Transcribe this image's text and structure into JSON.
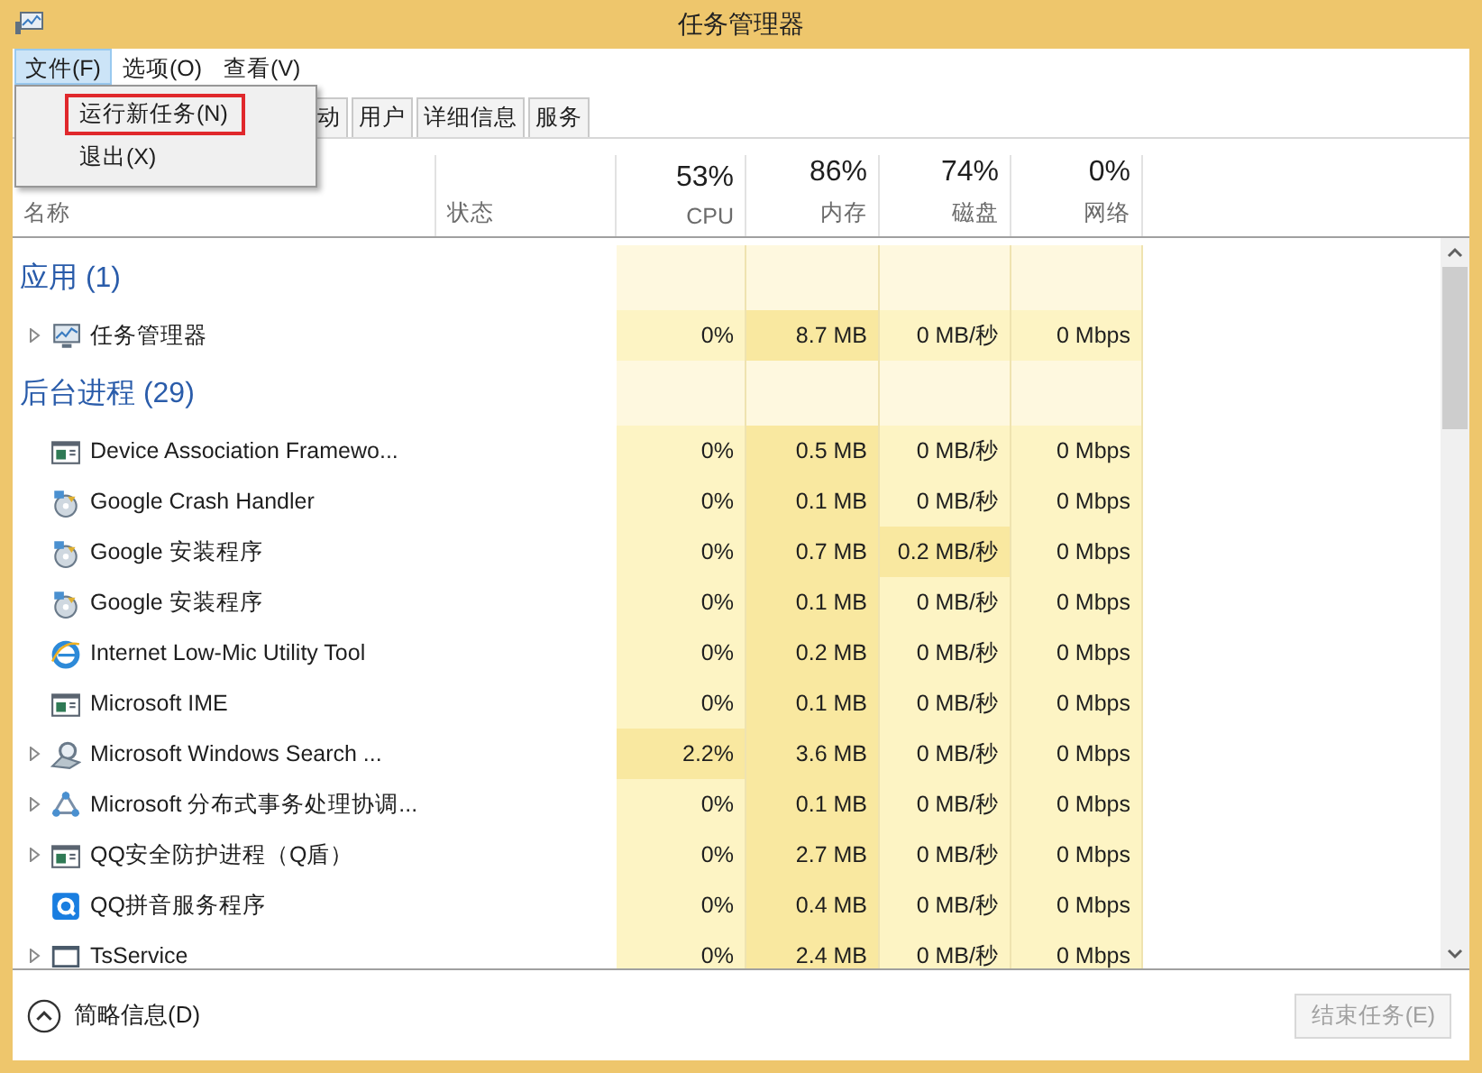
{
  "window": {
    "title": "任务管理器"
  },
  "menu_bar": [
    {
      "label": "文件(F)",
      "selected": true
    },
    {
      "label": "选项(O)",
      "selected": false
    },
    {
      "label": "查看(V)",
      "selected": false
    }
  ],
  "open_menu": {
    "items": [
      {
        "label": "运行新任务(N)",
        "highlighted": true
      },
      {
        "label": "退出(X)",
        "highlighted": false
      }
    ]
  },
  "tabs": [
    {
      "label": "动",
      "selected": false
    },
    {
      "label": "用户",
      "selected": false
    },
    {
      "label": "详细信息",
      "selected": false
    },
    {
      "label": "服务",
      "selected": false
    }
  ],
  "columns": [
    {
      "name": "名称"
    },
    {
      "name": "状态"
    },
    {
      "usage": "53%",
      "name": "CPU"
    },
    {
      "usage": "86%",
      "name": "内存"
    },
    {
      "usage": "74%",
      "name": "磁盘"
    },
    {
      "usage": "0%",
      "name": "网络"
    }
  ],
  "sections": [
    {
      "title": "应用 (1)",
      "rows": [
        {
          "name": "任务管理器",
          "kind": "monitor",
          "expandable": true,
          "cells": [
            {
              "text": "0%",
              "highlighted": false
            },
            {
              "text": "8.7 MB",
              "highlighted": true
            },
            {
              "text": "0 MB/秒",
              "highlighted": false
            },
            {
              "text": "0 Mbps",
              "highlighted": false
            }
          ]
        }
      ]
    },
    {
      "title": "后台进程 (29)",
      "rows": [
        {
          "name": "Device Association Framewo...",
          "kind": "window",
          "expandable": false,
          "cells": [
            {
              "text": "0%",
              "highlighted": false
            },
            {
              "text": "0.5 MB",
              "highlighted": true
            },
            {
              "text": "0 MB/秒",
              "highlighted": false
            },
            {
              "text": "0 Mbps",
              "highlighted": false
            }
          ]
        },
        {
          "name": "Google Crash Handler",
          "kind": "installer",
          "expandable": false,
          "cells": [
            {
              "text": "0%",
              "highlighted": false
            },
            {
              "text": "0.1 MB",
              "highlighted": true
            },
            {
              "text": "0 MB/秒",
              "highlighted": false
            },
            {
              "text": "0 Mbps",
              "highlighted": false
            }
          ]
        },
        {
          "name": "Google 安装程序",
          "kind": "installer",
          "expandable": false,
          "cells": [
            {
              "text": "0%",
              "highlighted": false
            },
            {
              "text": "0.7 MB",
              "highlighted": true
            },
            {
              "text": "0.2 MB/秒",
              "highlighted": true
            },
            {
              "text": "0 Mbps",
              "highlighted": false
            }
          ]
        },
        {
          "name": "Google 安装程序",
          "kind": "installer",
          "expandable": false,
          "cells": [
            {
              "text": "0%",
              "highlighted": false
            },
            {
              "text": "0.1 MB",
              "highlighted": true
            },
            {
              "text": "0 MB/秒",
              "highlighted": false
            },
            {
              "text": "0 Mbps",
              "highlighted": false
            }
          ]
        },
        {
          "name": "Internet Low-Mic Utility Tool",
          "kind": "browser",
          "expandable": false,
          "cells": [
            {
              "text": "0%",
              "highlighted": false
            },
            {
              "text": "0.2 MB",
              "highlighted": true
            },
            {
              "text": "0 MB/秒",
              "highlighted": false
            },
            {
              "text": "0 Mbps",
              "highlighted": false
            }
          ]
        },
        {
          "name": "Microsoft IME",
          "kind": "window",
          "expandable": false,
          "cells": [
            {
              "text": "0%",
              "highlighted": false
            },
            {
              "text": "0.1 MB",
              "highlighted": true
            },
            {
              "text": "0 MB/秒",
              "highlighted": false
            },
            {
              "text": "0 Mbps",
              "highlighted": false
            }
          ]
        },
        {
          "name": "Microsoft Windows Search ...",
          "kind": "search",
          "expandable": true,
          "cells": [
            {
              "text": "2.2%",
              "highlighted": true
            },
            {
              "text": "3.6 MB",
              "highlighted": true
            },
            {
              "text": "0 MB/秒",
              "highlighted": false
            },
            {
              "text": "0 Mbps",
              "highlighted": false
            }
          ]
        },
        {
          "name": "Microsoft 分布式事务处理协调...",
          "kind": "network",
          "expandable": true,
          "cells": [
            {
              "text": "0%",
              "highlighted": false
            },
            {
              "text": "0.1 MB",
              "highlighted": true
            },
            {
              "text": "0 MB/秒",
              "highlighted": false
            },
            {
              "text": "0 Mbps",
              "highlighted": false
            }
          ]
        },
        {
          "name": "QQ安全防护进程（Q盾）",
          "kind": "window",
          "expandable": true,
          "cells": [
            {
              "text": "0%",
              "highlighted": false
            },
            {
              "text": "2.7 MB",
              "highlighted": true
            },
            {
              "text": "0 MB/秒",
              "highlighted": false
            },
            {
              "text": "0 Mbps",
              "highlighted": false
            }
          ]
        },
        {
          "name": "QQ拼音服务程序",
          "kind": "q",
          "expandable": false,
          "cells": [
            {
              "text": "0%",
              "highlighted": false
            },
            {
              "text": "0.4 MB",
              "highlighted": true
            },
            {
              "text": "0 MB/秒",
              "highlighted": false
            },
            {
              "text": "0 Mbps",
              "highlighted": false
            }
          ]
        },
        {
          "name": "TsService",
          "kind": "blank",
          "expandable": true,
          "cells": [
            {
              "text": "0%",
              "highlighted": false
            },
            {
              "text": "2.4 MB",
              "highlighted": true
            },
            {
              "text": "0 MB/秒",
              "highlighted": false
            },
            {
              "text": "0 Mbps",
              "highlighted": false
            }
          ]
        }
      ]
    }
  ],
  "footer": {
    "details_toggle": "简略信息(D)",
    "end_task_button": {
      "label": "结束任务(E)",
      "disabled": true
    }
  }
}
